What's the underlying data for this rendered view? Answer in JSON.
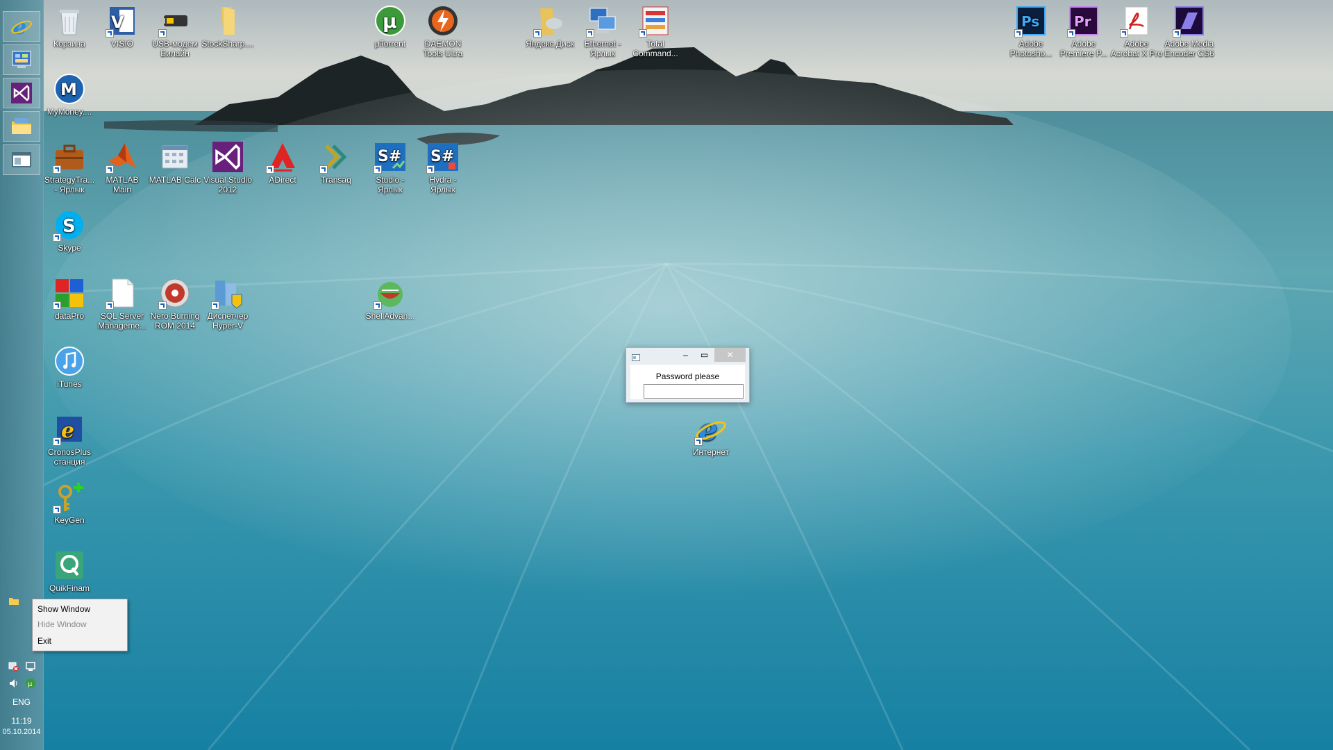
{
  "desktop": {
    "icons": [
      {
        "label": "Корзина",
        "icon": "recycle-bin-icon"
      },
      {
        "label": "VISIO",
        "icon": "visio-icon"
      },
      {
        "label": "USB-модем Билайн",
        "icon": "usb-modem-icon"
      },
      {
        "label": "StockSharp....",
        "icon": "folder-icon"
      },
      {
        "label": "µTorrent",
        "icon": "utorrent-icon"
      },
      {
        "label": "DAEMON Tools Ultra",
        "icon": "daemon-tools-icon"
      },
      {
        "label": "Яндекс.Диск",
        "icon": "yandex-disk-icon"
      },
      {
        "label": "Ethernet - Ярлык",
        "icon": "network-icon"
      },
      {
        "label": "Total Command...",
        "icon": "total-commander-icon"
      },
      {
        "label": "Adobe Photosho...",
        "icon": "photoshop-icon"
      },
      {
        "label": "Adobe Premiere P...",
        "icon": "premiere-icon"
      },
      {
        "label": "Adobe Acrobat X Pro",
        "icon": "acrobat-icon"
      },
      {
        "label": "Adobe Media Encoder CS6",
        "icon": "media-encoder-icon"
      },
      {
        "label": "MyMoney....",
        "icon": "mymoney-icon"
      },
      {
        "label": "StrategyTra... - Ярлык",
        "icon": "briefcase-icon"
      },
      {
        "label": "MATLAB Main",
        "icon": "matlab-icon"
      },
      {
        "label": "MATLAB Calc",
        "icon": "calculator-grid-icon"
      },
      {
        "label": "Visual Studio 2012",
        "icon": "visual-studio-icon"
      },
      {
        "label": "ADirect",
        "icon": "adirect-icon"
      },
      {
        "label": "Transaq",
        "icon": "transaq-icon"
      },
      {
        "label": "Studio - Ярлык",
        "icon": "sharp-studio-icon"
      },
      {
        "label": "Hydra - Ярлык",
        "icon": "sharp-hydra-icon"
      },
      {
        "label": "Skype",
        "icon": "skype-icon"
      },
      {
        "label": "dataPro",
        "icon": "datapro-icon"
      },
      {
        "label": "SQL Server Manageme...",
        "icon": "blank-document-icon"
      },
      {
        "label": "Nero Burning ROM 2014",
        "icon": "nero-icon"
      },
      {
        "label": "Диспетчер Hyper-V",
        "icon": "hyper-v-icon"
      },
      {
        "label": "ShellAdvan...",
        "icon": "shell-advanced-icon"
      },
      {
        "label": "iTunes",
        "icon": "itunes-icon"
      },
      {
        "label": "CronosPlus станция",
        "icon": "cronos-icon"
      },
      {
        "label": "KeyGen",
        "icon": "key-icon"
      },
      {
        "label": "QuikFinam",
        "icon": "quik-icon"
      },
      {
        "label": "Интернет",
        "icon": "internet-explorer-icon"
      }
    ]
  },
  "taskbar": {
    "pinned": [
      {
        "icon": "internet-explorer-icon"
      },
      {
        "icon": "control-panel-icon"
      },
      {
        "icon": "visual-studio-icon"
      },
      {
        "icon": "file-explorer-icon"
      },
      {
        "icon": "window-app-icon"
      }
    ],
    "tray": {
      "language": "ENG",
      "time": "11:19",
      "date": "05.10.2014"
    }
  },
  "dialog": {
    "prompt": "Password please",
    "input_value": "",
    "minimize_symbol": "–",
    "maximize_symbol": "▭",
    "close_symbol": "✕"
  },
  "context_menu": {
    "items": [
      {
        "label": "Show Window",
        "enabled": true
      },
      {
        "label": "Hide Window",
        "enabled": false
      },
      {
        "label": "Exit",
        "enabled": true
      }
    ]
  },
  "colors": {
    "accent_sea": "#1f8aa6",
    "dialog_bg": "#e9eef2",
    "menu_bg": "#f2f2f2"
  }
}
